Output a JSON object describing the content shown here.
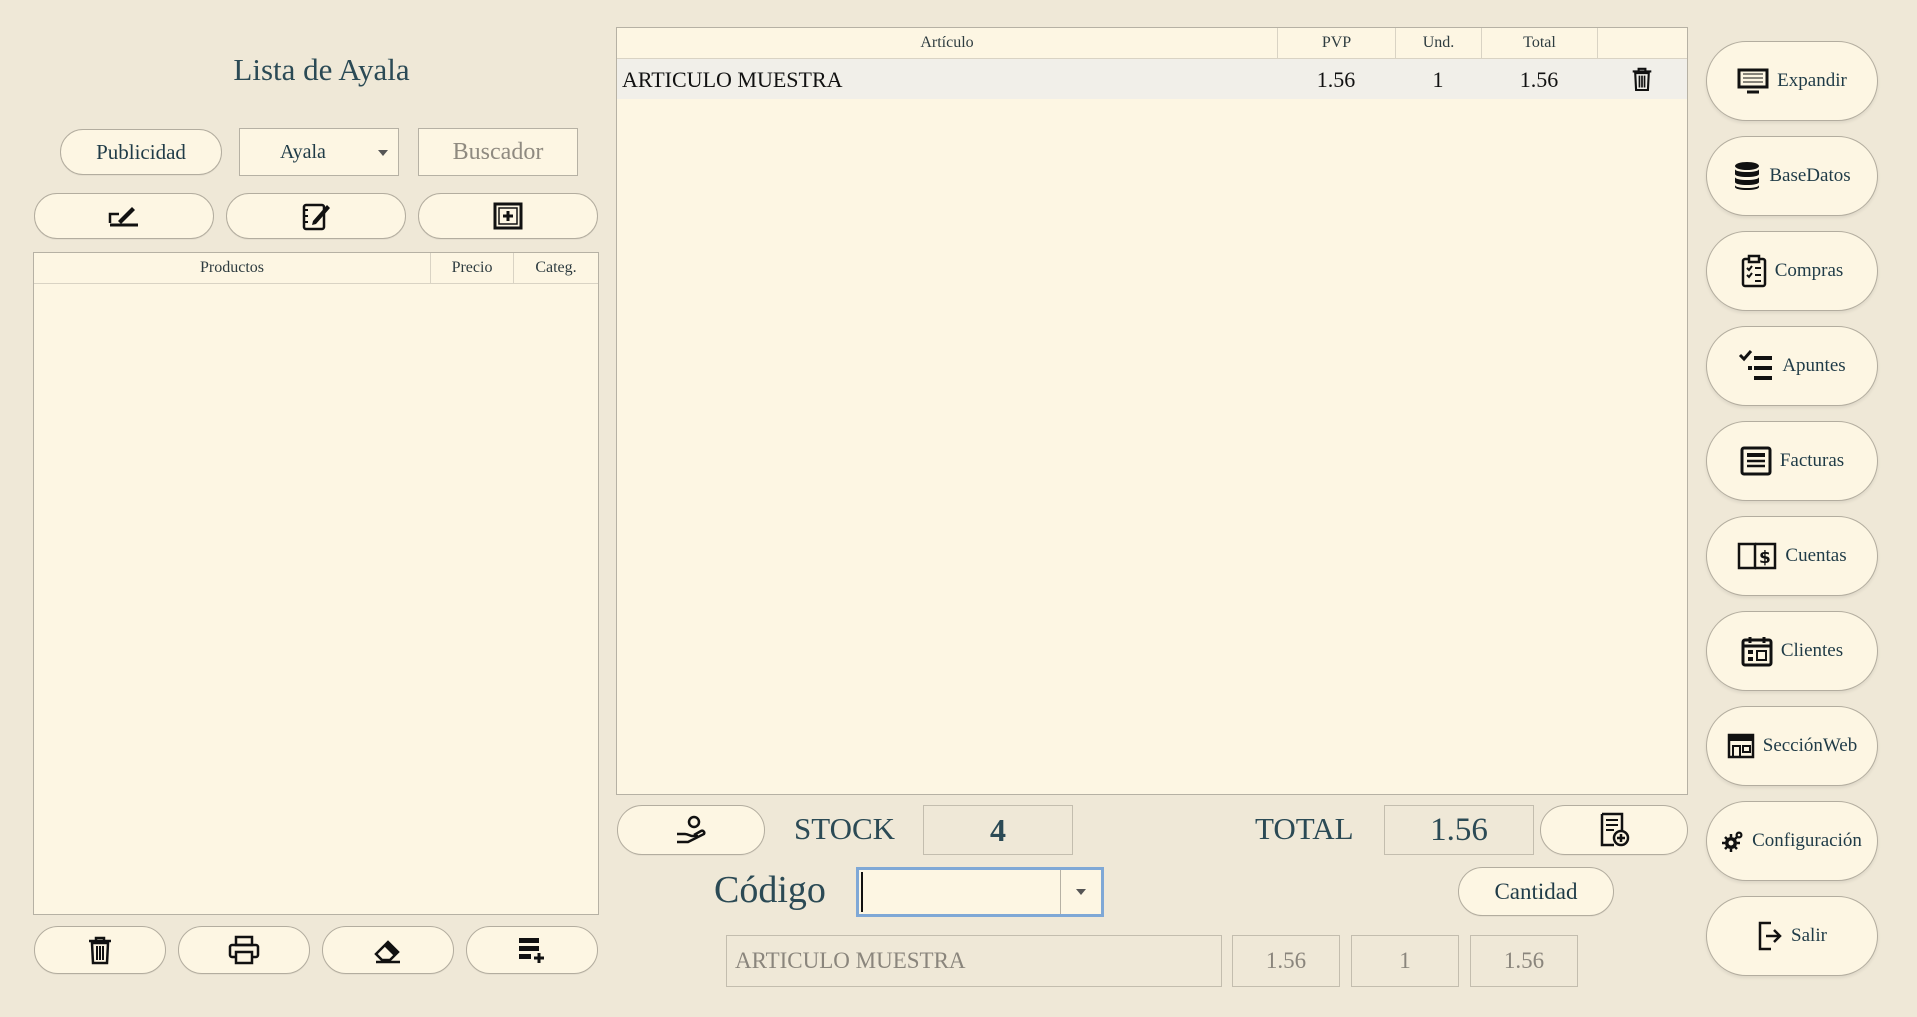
{
  "left_panel": {
    "title": "Lista de Ayala",
    "publicidad_label": "Publicidad",
    "list_select": {
      "selected": "Ayala"
    },
    "search": {
      "placeholder": "Buscador",
      "value": ""
    },
    "products_table": {
      "columns": [
        "Productos",
        "Precio",
        "Categ."
      ],
      "rows": []
    },
    "toolbar_icons": [
      "edit-signature-icon",
      "edit-note-icon",
      "add-box-icon"
    ],
    "bottom_icons": [
      "trash-icon",
      "print-icon",
      "eraser-icon",
      "add-list-icon"
    ]
  },
  "cart": {
    "columns": [
      "Artículo",
      "PVP",
      "Und.",
      "Total"
    ],
    "rows": [
      {
        "articulo": "ARTICULO MUESTRA",
        "pvp": "1.56",
        "und": "1",
        "total": "1.56",
        "action_icon": "trash-icon"
      }
    ]
  },
  "footer": {
    "stock_label": "STOCK",
    "stock_value": "4",
    "total_label": "TOTAL",
    "total_value": "1.56",
    "codigo_label": "Código",
    "codigo_value": "",
    "cantidad_label": "Cantidad",
    "preview": {
      "articulo": "ARTICULO MUESTRA",
      "pvp": "1.56",
      "und": "1",
      "total": "1.56"
    }
  },
  "sidebar": {
    "items": [
      {
        "label": "Expandir",
        "icon": "monitor-icon"
      },
      {
        "label": "BaseDatos",
        "icon": "database-icon"
      },
      {
        "label": "Compras",
        "icon": "clipboard-check-icon"
      },
      {
        "label": "Apuntes",
        "icon": "checklist-icon"
      },
      {
        "label": "Facturas",
        "icon": "invoice-icon"
      },
      {
        "label": "Cuentas",
        "icon": "ledger-dollar-icon"
      },
      {
        "label": "Clientes",
        "icon": "calendar-icon"
      },
      {
        "label": "SecciónWeb",
        "icon": "storefront-icon"
      },
      {
        "label": "Configuración",
        "icon": "gears-icon"
      },
      {
        "label": "Salir",
        "icon": "exit-icon"
      }
    ]
  },
  "colors": {
    "background": "#efe8d7",
    "panel": "#fdf6e3",
    "text": "#1f3b47",
    "focus_border": "#7fa8d6"
  }
}
